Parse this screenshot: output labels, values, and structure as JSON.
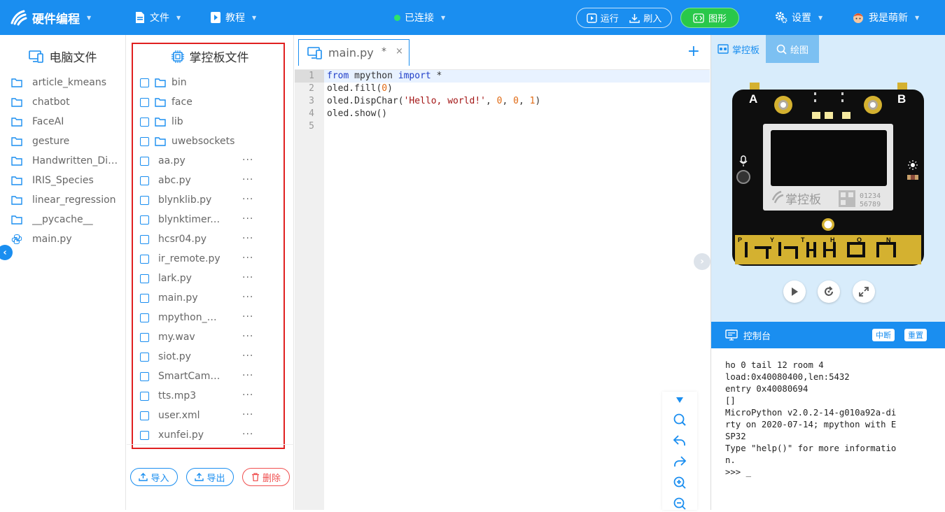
{
  "topbar": {
    "brand": "硬件编程",
    "menu_file": "文件",
    "menu_tutorial": "教程",
    "connection": "已连接",
    "run": "运行",
    "flash": "刷入",
    "graphic": "图形",
    "settings": "设置",
    "user": "我是萌新",
    "colors": {
      "bar": "#1a8ef0",
      "connected": "#2ee36a",
      "graphic_button": "#29c84a"
    }
  },
  "pc_panel": {
    "title": "电脑文件",
    "items": [
      {
        "label": "article_kmeans",
        "type": "folder"
      },
      {
        "label": "chatbot",
        "type": "folder"
      },
      {
        "label": "FaceAI",
        "type": "folder"
      },
      {
        "label": "gesture",
        "type": "folder"
      },
      {
        "label": "Handwritten_Digit...",
        "type": "folder"
      },
      {
        "label": "IRIS_Species",
        "type": "folder"
      },
      {
        "label": "linear_regression",
        "type": "folder"
      },
      {
        "label": "__pycache__",
        "type": "folder"
      },
      {
        "label": "main.py",
        "type": "python"
      }
    ]
  },
  "board_panel": {
    "title": "掌控板文件",
    "items": [
      {
        "label": "bin",
        "type": "folder"
      },
      {
        "label": "face",
        "type": "folder"
      },
      {
        "label": "lib",
        "type": "folder"
      },
      {
        "label": "uwebsockets",
        "type": "folder"
      },
      {
        "label": "aa.py",
        "type": "file"
      },
      {
        "label": "abc.py",
        "type": "file"
      },
      {
        "label": "blynklib.py",
        "type": "file"
      },
      {
        "label": "blynktimer.py",
        "type": "file"
      },
      {
        "label": "hcsr04.py",
        "type": "file"
      },
      {
        "label": "ir_remote.py",
        "type": "file"
      },
      {
        "label": "lark.py",
        "type": "file"
      },
      {
        "label": "main.py",
        "type": "file"
      },
      {
        "label": "mpython_ext...",
        "type": "file"
      },
      {
        "label": "my.wav",
        "type": "file"
      },
      {
        "label": "siot.py",
        "type": "file"
      },
      {
        "label": "SmartCamer...",
        "type": "file"
      },
      {
        "label": "tts.mp3",
        "type": "file"
      },
      {
        "label": "user.xml",
        "type": "file"
      },
      {
        "label": "xunfei.py",
        "type": "file"
      }
    ],
    "more": "···",
    "import": "导入",
    "export": "导出",
    "delete": "删除",
    "highlight_color": "#e02020"
  },
  "editor": {
    "tab": {
      "name": "main.py",
      "modified": "*",
      "close": "×"
    },
    "add_tab": "+",
    "lines": [
      "1",
      "2",
      "3",
      "4",
      "5"
    ]
  },
  "right_panel": {
    "tab_board": "掌控板",
    "tab_draw": "绘图",
    "board": {
      "label_a": "A",
      "label_b": "B",
      "logo_text": "掌控板",
      "serial": "01234",
      "serial2": "56789",
      "pins": [
        "P",
        "Y",
        "T",
        "H",
        "O",
        "N"
      ]
    },
    "console_title": "控制台",
    "interrupt": "中断",
    "reset": "重置",
    "console_lines": [
      "ho 0 tail 12 room 4",
      "load:0x40080400,len:5432",
      "entry 0x40080694",
      "[]",
      "MicroPython v2.0.2-14-g010a92a-di",
      "rty on 2020-07-14; mpython with E",
      "SP32",
      "Type \"help()\" for more informatio",
      "n.",
      ">>> _"
    ]
  }
}
